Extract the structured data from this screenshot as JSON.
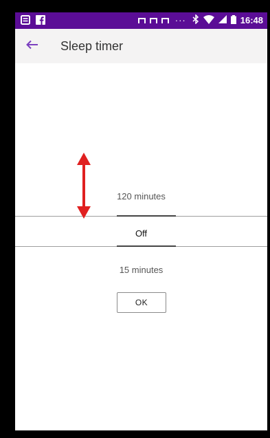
{
  "status_bar": {
    "time": "16:48",
    "dots": "···",
    "left_icons": [
      "notes-icon",
      "facebook-icon"
    ],
    "right_icons": [
      "bluetooth-icon",
      "wifi-icon",
      "signal-icon",
      "battery-icon"
    ]
  },
  "app_bar": {
    "title": "Sleep timer",
    "back_icon": "arrow-back-icon"
  },
  "picker": {
    "above": "120 minutes",
    "selected": "Off",
    "below": "15 minutes"
  },
  "ok_button": {
    "label": "OK"
  },
  "colors": {
    "status_bar": "#5b0d96",
    "accent": "#7b3fbf",
    "arrow": "#e02020"
  }
}
